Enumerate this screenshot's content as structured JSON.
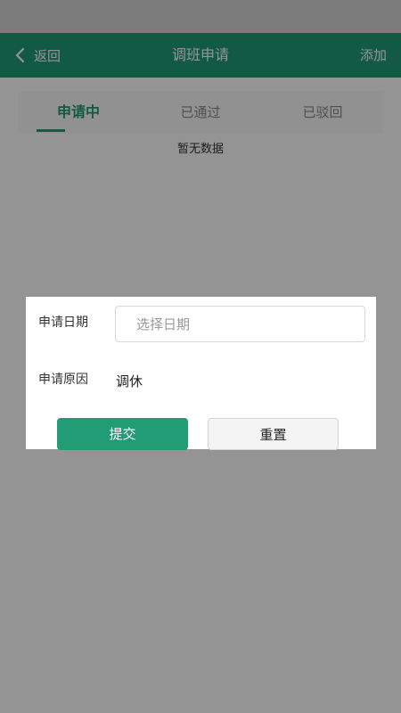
{
  "header": {
    "back_label": "返回",
    "title": "调班申请",
    "add_label": "添加"
  },
  "tabs": [
    {
      "label": "申请中",
      "active": true
    },
    {
      "label": "已通过",
      "active": false
    },
    {
      "label": "已驳回",
      "active": false
    }
  ],
  "empty_text": "暂无数据",
  "dialog": {
    "date_label": "申请日期",
    "date_placeholder": "选择日期",
    "reason_label": "申请原因",
    "reason_value": "调休",
    "submit_label": "提交",
    "reset_label": "重置"
  },
  "colors": {
    "primary": "#229c75",
    "overlay": "rgba(0,0,0,0.42)"
  },
  "icons": {
    "back": "chevron-left-icon"
  }
}
